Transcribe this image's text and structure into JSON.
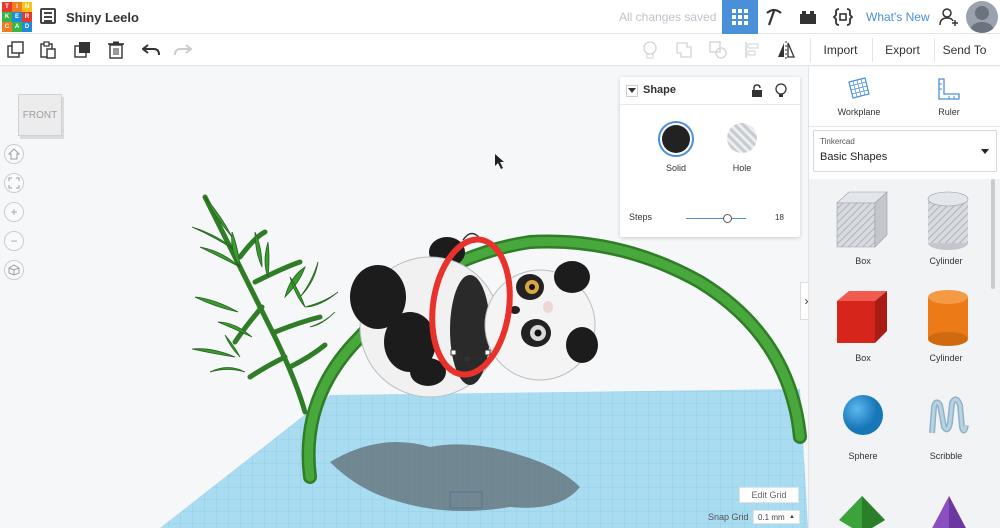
{
  "header": {
    "logo_letters": [
      "T",
      "I",
      "N",
      "K",
      "E",
      "R",
      "C",
      "A",
      "D"
    ],
    "logo_colors": [
      "#e23b2e",
      "#f37b21",
      "#f7c31c",
      "#3bb44a",
      "#1f8dd6",
      "#e23b2e",
      "#f37b21",
      "#3bb44a",
      "#1f8dd6"
    ],
    "design_title": "Shiny Leelo",
    "save_status": "All changes saved",
    "whats_new": "What's New"
  },
  "toolbar": {
    "import_label": "Import",
    "export_label": "Export",
    "send_to_label": "Send To"
  },
  "viewport": {
    "viewcube_label": "FRONT",
    "edit_grid_label": "Edit Grid",
    "snap_grid_label": "Snap Grid",
    "snap_grid_value": "0.1 mm"
  },
  "shape_panel": {
    "title": "Shape",
    "solid_label": "Solid",
    "hole_label": "Hole",
    "steps_label": "Steps",
    "steps_value": "18"
  },
  "sidebar": {
    "workplane_label": "Workplane",
    "ruler_label": "Ruler",
    "category_small": "Tinkercad",
    "category_value": "Basic Shapes",
    "shapes": [
      {
        "name": "Box"
      },
      {
        "name": "Cylinder"
      },
      {
        "name": "Box"
      },
      {
        "name": "Cylinder"
      },
      {
        "name": "Sphere"
      },
      {
        "name": "Scribble"
      }
    ]
  },
  "colors": {
    "accent": "#4a90d9",
    "bamboo": "#3a9b2f",
    "workplane": "#a9dcf0",
    "highlight_circle": "#e8322b"
  }
}
